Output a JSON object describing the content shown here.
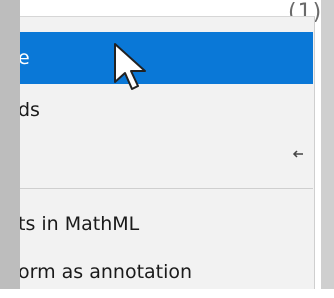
{
  "background": {
    "partial_text": "(1)"
  },
  "menu": {
    "items": [
      {
        "label": "e",
        "state": "highlighted"
      },
      {
        "label": "ds"
      },
      {
        "label": "",
        "shortcut_icon": "arrow-left-icon"
      },
      {
        "label": "ts in MathML"
      },
      {
        "label": "orm as annotation"
      }
    ]
  },
  "colors": {
    "highlight": "#0a78d7",
    "menu_bg": "#f2f2f2",
    "left_strip": "#bdbdbd",
    "right_strip": "#cfcfcf"
  },
  "cursor": {
    "icon": "mouse-pointer-icon"
  }
}
